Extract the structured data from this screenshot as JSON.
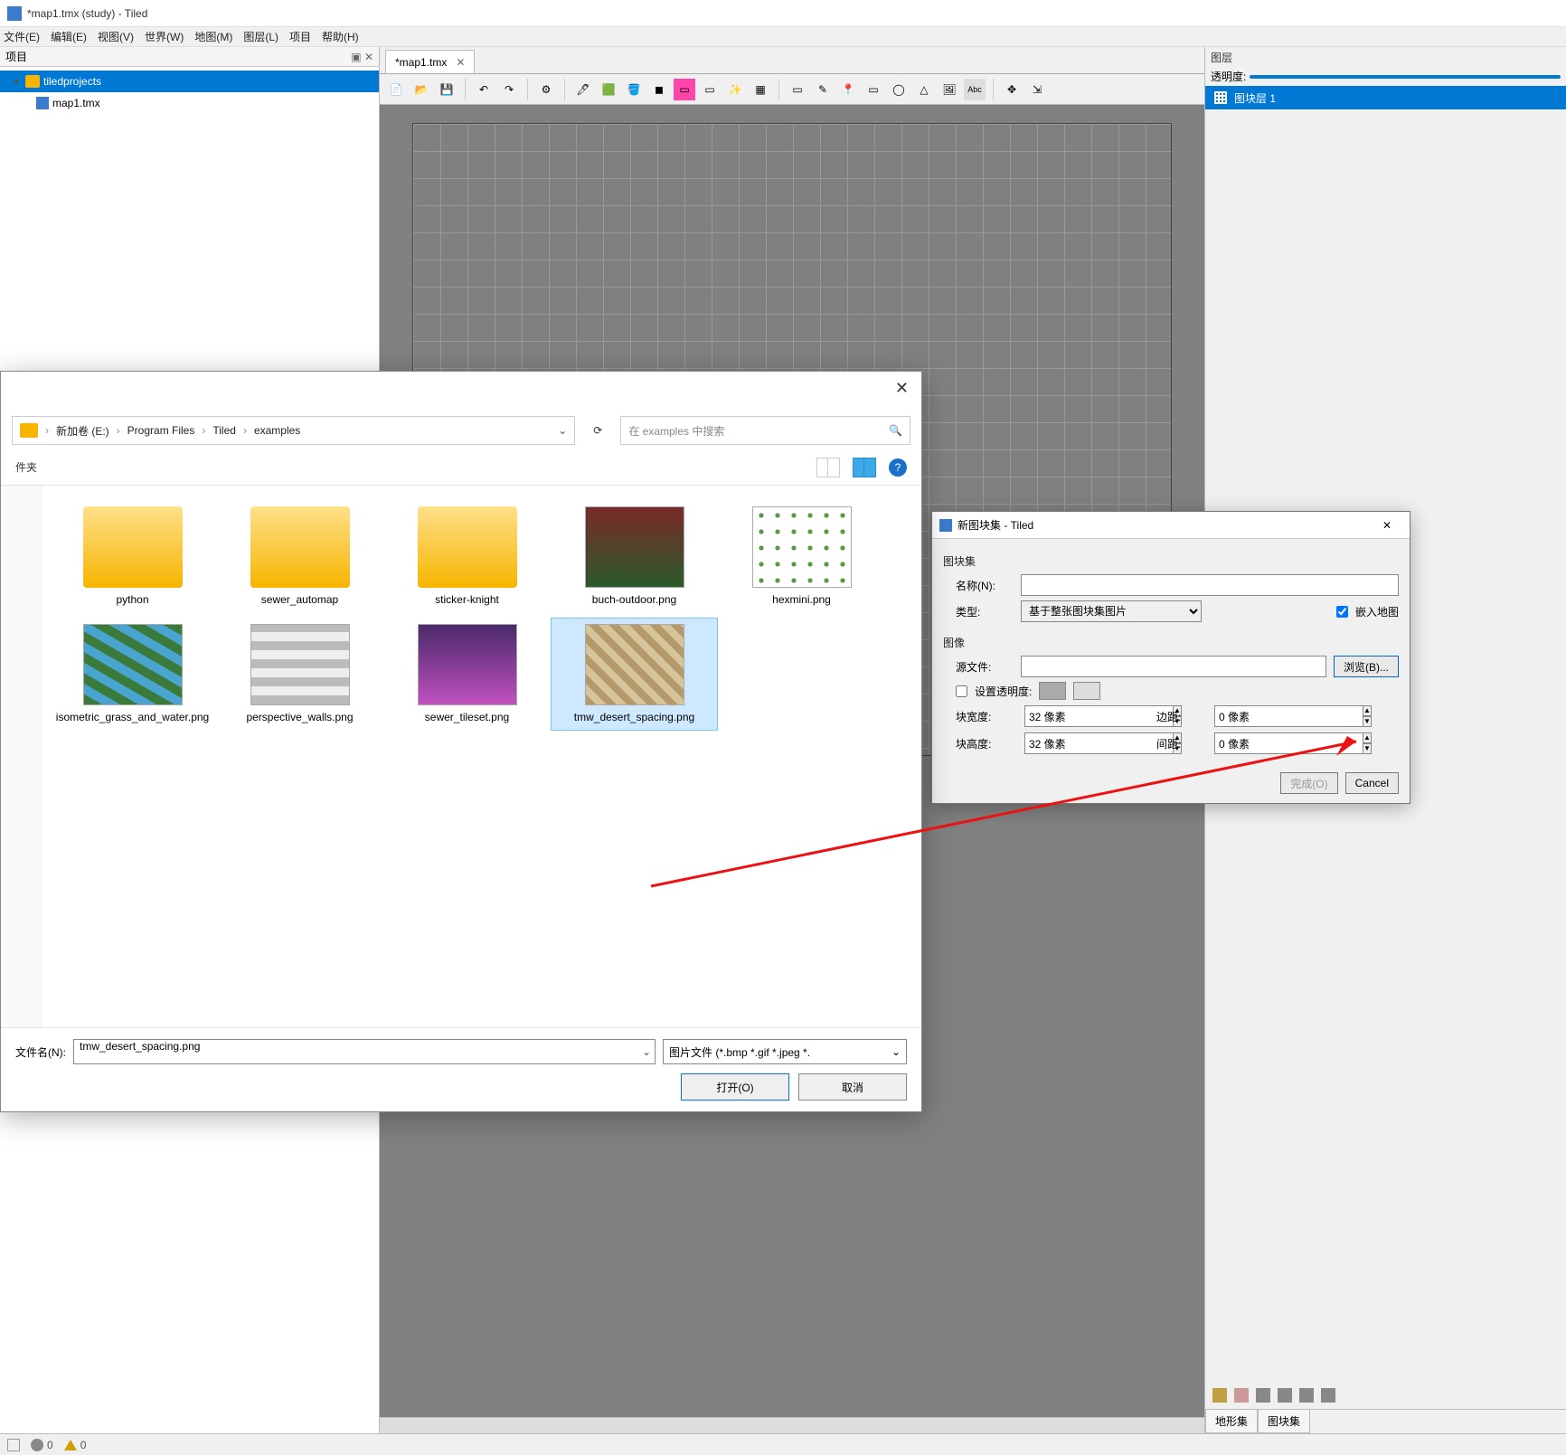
{
  "window_title": "*map1.tmx (study) - Tiled",
  "menus": [
    "文件(E)",
    "编辑(E)",
    "视图(V)",
    "世界(W)",
    "地图(M)",
    "图层(L)",
    "项目",
    "帮助(H)"
  ],
  "project": {
    "title": "项目",
    "root": "tiledprojects",
    "file": "map1.tmx"
  },
  "tab": {
    "label": "*map1.tmx"
  },
  "layers_panel": {
    "title": "图层",
    "opacity_label": "透明度:",
    "layer1": "图块层 1",
    "bottom_tab_terrain": "地形集",
    "bottom_tab_tileset": "图块集"
  },
  "status": {
    "err": "0",
    "warn": "0"
  },
  "tileset_dialog": {
    "title": "新图块集 - Tiled",
    "section_tileset": "图块集",
    "name_label": "名称(N):",
    "name_value": "",
    "type_label": "类型:",
    "type_value": "基于整张图块集图片",
    "embed_label": "嵌入地图",
    "section_image": "图像",
    "source_label": "源文件:",
    "source_value": "",
    "browse_btn": "浏览(B)...",
    "set_trans_label": "设置透明度:",
    "tile_w_label": "块宽度:",
    "tile_w_value": "32 像素",
    "tile_h_label": "块高度:",
    "tile_h_value": "32 像素",
    "margin_label": "边距:",
    "margin_value": "0 像素",
    "spacing_label": "间距:",
    "spacing_value": "0 像素",
    "finish_btn": "完成(O)",
    "cancel_btn": "Cancel"
  },
  "open_dialog": {
    "folder_label": "件夹",
    "crumb": [
      "新加卷 (E:)",
      "Program Files",
      "Tiled",
      "examples"
    ],
    "search_placeholder": "在 examples 中搜索",
    "files": [
      {
        "name": "python",
        "type": "folder"
      },
      {
        "name": "sewer_automap",
        "type": "folder"
      },
      {
        "name": "sticker-knight",
        "type": "folder"
      },
      {
        "name": "buch-outdoor.png",
        "type": "img"
      },
      {
        "name": "hexmini.png",
        "type": "img"
      },
      {
        "name": "isometric_grass_and_water.png",
        "type": "img"
      },
      {
        "name": "perspective_walls.png",
        "type": "img"
      },
      {
        "name": "sewer_tileset.png",
        "type": "img"
      },
      {
        "name": "tmw_desert_spacing.png",
        "type": "img",
        "selected": true
      }
    ],
    "filename_label": "文件名(N):",
    "filename_value": "tmw_desert_spacing.png",
    "filter_value": "图片文件 (*.bmp *.gif *.jpeg *.",
    "open_btn": "打开(O)",
    "cancel_btn": "取消"
  }
}
